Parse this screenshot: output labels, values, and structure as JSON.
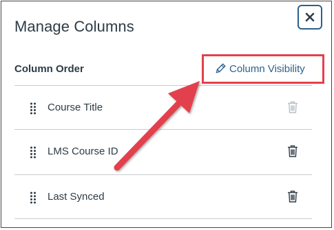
{
  "dialog": {
    "title": "Manage Columns",
    "close_icon": "close-icon",
    "section_label": "Column Order",
    "visibility_link": {
      "label": "Column Visibility",
      "icon": "pencil-icon"
    },
    "columns": [
      {
        "label": "Course Title",
        "drag_icon": "drag-handle-icon",
        "delete_icon": "trash-icon",
        "delete_enabled": false
      },
      {
        "label": "LMS Course ID",
        "drag_icon": "drag-handle-icon",
        "delete_icon": "trash-icon",
        "delete_enabled": true
      },
      {
        "label": "Last Synced",
        "drag_icon": "drag-handle-icon",
        "delete_icon": "trash-icon",
        "delete_enabled": true
      }
    ]
  },
  "annotation": {
    "highlight_color": "#e3404d",
    "arrow_color": "#e3404d"
  },
  "colors": {
    "link": "#2b5f8c",
    "text": "#2d3b45",
    "disabled_icon": "#b8bfc4"
  }
}
